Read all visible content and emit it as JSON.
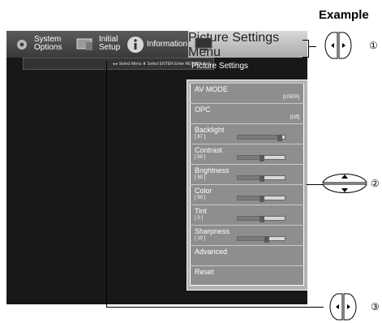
{
  "example_label": "Example",
  "topbar": {
    "items": [
      {
        "label_line1": "System",
        "label_line2": "Options"
      },
      {
        "label_line1": "Initial",
        "label_line2": "Setup"
      },
      {
        "label_line1": "Information",
        "label_line2": ""
      },
      {
        "label_line1": "Picture",
        "label_line2": "Settings"
      }
    ],
    "menu_label": "Menu"
  },
  "subbar_text": "◂ ▸ Select Menu  ⬍ Select  ENTER Enter  RETURN Exit",
  "panel": {
    "title": "Picture Settings",
    "rows": [
      {
        "name": "AV MODE",
        "right": "[USER]"
      },
      {
        "name": "OPC",
        "right": "[Off]"
      },
      {
        "name": "Backlight",
        "value": "[ 87 ]",
        "level": 0.87
      },
      {
        "name": "Contrast",
        "value": "[ 50 ]",
        "level": 0.5
      },
      {
        "name": "Brightness",
        "value": "[ 50 ]",
        "level": 0.5
      },
      {
        "name": "Color",
        "value": "[ 50 ]",
        "level": 0.5
      },
      {
        "name": "Tint",
        "value": "[   0 ]",
        "level": 0.5
      },
      {
        "name": "Sharpness",
        "value": "[ 10 ]",
        "level": 0.6
      },
      {
        "name": "Advanced"
      },
      {
        "name": "Reset"
      }
    ]
  },
  "callouts": [
    "①",
    "②",
    "③"
  ]
}
